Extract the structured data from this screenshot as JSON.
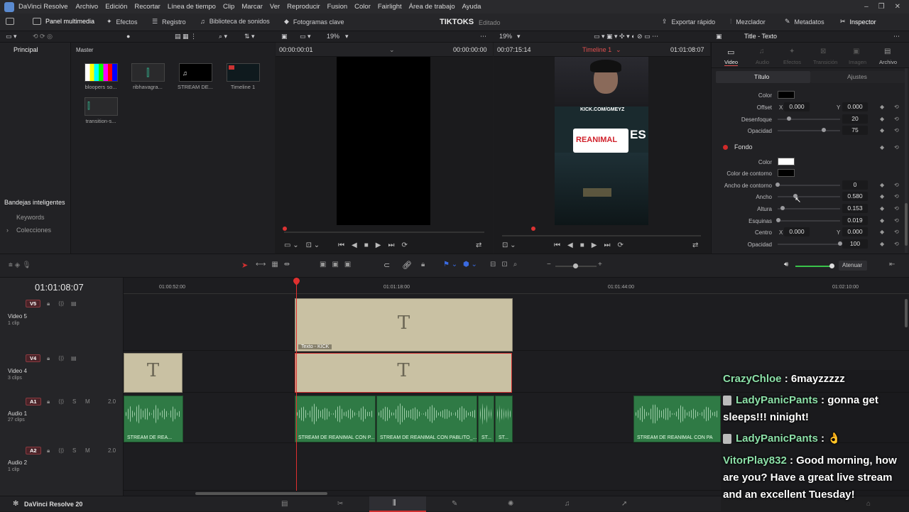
{
  "menubar": {
    "app_name": "DaVinci Resolve",
    "items": [
      "Archivo",
      "Edición",
      "Recortar",
      "Línea de tiempo",
      "Clip",
      "Marcar",
      "Ver",
      "Reproducir",
      "Fusion",
      "Color",
      "Fairlight",
      "Área de trabajo",
      "Ayuda"
    ]
  },
  "toolbar": {
    "media_panel": "Panel multimedia",
    "effects": "Efectos",
    "log": "Registro",
    "sound_library": "Biblioteca de sonidos",
    "keyframes": "Fotogramas clave",
    "project_title": "TIKTOKS",
    "project_status": "Editado",
    "quick_export": "Exportar rápido",
    "mixer": "Mezclador",
    "metadata": "Metadatos",
    "inspector": "Inspector"
  },
  "subbar": {
    "zoom1": "19%",
    "zoom2": "19%",
    "inspector_title": "Title - Texto"
  },
  "mediapool": {
    "sidebar_main": "Principal",
    "bin": "Master",
    "smart_bins": "Bandejas inteligentes",
    "keywords": "Keywords",
    "collections": "Colecciones",
    "clips": [
      {
        "label": "bloopers so..."
      },
      {
        "label": "ribhavagra..."
      },
      {
        "label": "STREAM DE..."
      },
      {
        "label": "Timeline 1"
      },
      {
        "label": "transition-s..."
      }
    ]
  },
  "viewer1": {
    "tc_left": "00:00:00:01",
    "tc_right": "00:00:00:00"
  },
  "viewer2": {
    "tc_left": "00:07:15:14",
    "timeline_name": "Timeline 1",
    "tc_right": "01:01:08:07",
    "overlay_url": "KICK.COM/GMEYZ",
    "overlay_title": "REANIMAL",
    "overlay_fragment": "ES"
  },
  "inspector": {
    "tabs": [
      "Video",
      "Audio",
      "Efectos",
      "Transición",
      "Imagen",
      "Archivo"
    ],
    "subtabs": [
      "Título",
      "Ajustes"
    ],
    "rows": {
      "color_label": "Color",
      "offset_label": "Offset",
      "offset_x": "0.000",
      "offset_y": "0.000",
      "blur_label": "Desenfoque",
      "blur_val": "20",
      "opacity_label": "Opacidad",
      "opacity_val": "75",
      "section": "Fondo",
      "fcolor_label": "Color",
      "outline_color_label": "Color de contorno",
      "outline_width_label": "Ancho de contorno",
      "outline_width_val": "0",
      "width_label": "Ancho",
      "width_val": "0.580",
      "height_label": "Altura",
      "height_val": "0.153",
      "corners_label": "Esquinas",
      "corners_val": "0.019",
      "center_label": "Centro",
      "center_x": "0.000",
      "center_y": "0.000",
      "fopacity_label": "Opacidad",
      "fopacity_val": "100",
      "x": "X",
      "y": "Y"
    },
    "colors": {
      "shadow": "#000000",
      "fill": "#ffffff",
      "outline": "#000000"
    }
  },
  "timeline": {
    "timecode": "01:01:08:07",
    "ruler": [
      "01:00:52:00",
      "01:01:18:00",
      "01:01:44:00",
      "01:02:10:00"
    ],
    "mute_label": "Atenuar",
    "tracks": [
      {
        "badge": "V5",
        "name": "Video 5",
        "sub": "1 clip"
      },
      {
        "badge": "V4",
        "name": "Video 4",
        "sub": "3 clips"
      },
      {
        "badge": "A1",
        "name": "Audio 1",
        "sub": "27 clips",
        "level": "2.0"
      },
      {
        "badge": "A2",
        "name": "Audio 2",
        "sub": "1 clip",
        "level": "2.0"
      }
    ],
    "text_clip_label": "Texto - KICK",
    "text_glyph": "T",
    "audio_clips": [
      "STREAM DE REA...",
      "STREAM DE REANIMAL CON P...",
      "STREAM DE REANIMAL CON PABLITO_...",
      "ST...",
      "ST...",
      "STREAM DE REANIMAL CON PA"
    ]
  },
  "bottombar": {
    "label": "DaVinci Resolve 20"
  },
  "chat": [
    {
      "name": "CrazyChloe",
      "text": " : 6mayzzzzz"
    },
    {
      "name": "LadyPanicPants",
      "text": " : gonna get sleeps!!! ninight!"
    },
    {
      "name": "LadyPanicPants",
      "text": " : 👌"
    },
    {
      "name": "VitorPlay832",
      "text": " : Good morning, how are you? Have a great live stream and an excellent Tuesday!"
    }
  ]
}
